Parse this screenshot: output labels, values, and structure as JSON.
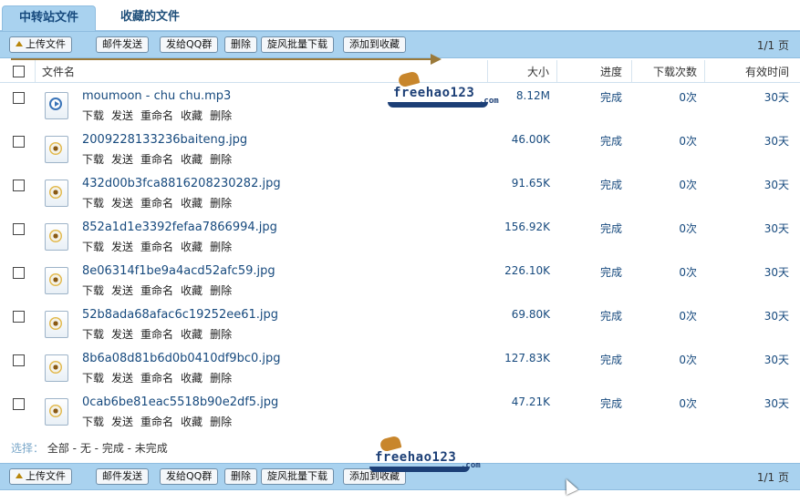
{
  "tabs": [
    {
      "label": "中转站文件",
      "active": true
    },
    {
      "label": "收藏的文件",
      "active": false
    }
  ],
  "toolbar": {
    "buttons": [
      "上传文件",
      "邮件发送",
      "发给QQ群",
      "删除",
      "旋风批量下载",
      "添加到收藏"
    ],
    "page_info": "1/1 页"
  },
  "table": {
    "headers": {
      "name": "文件名",
      "size": "大小",
      "progress": "进度",
      "downloads": "下载次数",
      "valid": "有效时间"
    },
    "row_actions": [
      "下载",
      "发送",
      "重命名",
      "收藏",
      "删除"
    ],
    "rows": [
      {
        "name": "moumoon - chu chu.mp3",
        "size": "8.12M",
        "progress": "完成",
        "downloads": "0次",
        "valid": "30天",
        "icon": "audio-file-icon"
      },
      {
        "name": "2009228133236baiteng.jpg",
        "size": "46.00K",
        "progress": "完成",
        "downloads": "0次",
        "valid": "30天",
        "icon": "image-file-icon"
      },
      {
        "name": "432d00b3fca8816208230282.jpg",
        "size": "91.65K",
        "progress": "完成",
        "downloads": "0次",
        "valid": "30天",
        "icon": "image-file-icon"
      },
      {
        "name": "852a1d1e3392fefaa7866994.jpg",
        "size": "156.92K",
        "progress": "完成",
        "downloads": "0次",
        "valid": "30天",
        "icon": "image-file-icon"
      },
      {
        "name": "8e06314f1be9a4acd52afc59.jpg",
        "size": "226.10K",
        "progress": "完成",
        "downloads": "0次",
        "valid": "30天",
        "icon": "image-file-icon"
      },
      {
        "name": "52b8ada68afac6c19252ee61.jpg",
        "size": "69.80K",
        "progress": "完成",
        "downloads": "0次",
        "valid": "30天",
        "icon": "image-file-icon"
      },
      {
        "name": "8b6a08d81b6d0b0410df9bc0.jpg",
        "size": "127.83K",
        "progress": "完成",
        "downloads": "0次",
        "valid": "30天",
        "icon": "image-file-icon"
      },
      {
        "name": "0cab6be81eac5518b90e2df5.jpg",
        "size": "47.21K",
        "progress": "完成",
        "downloads": "0次",
        "valid": "30天",
        "icon": "image-file-icon"
      }
    ]
  },
  "select": {
    "label": "选择：",
    "all": "全部",
    "none": "无",
    "done": "完成",
    "undone": "未完成",
    "sep": " - "
  },
  "watermark": {
    "text": "freehao123",
    "suffix": ".com"
  },
  "colors": {
    "toolbar_bg": "#a9d2ef",
    "link": "#174a7e",
    "arrow": "#9b7a3a"
  }
}
